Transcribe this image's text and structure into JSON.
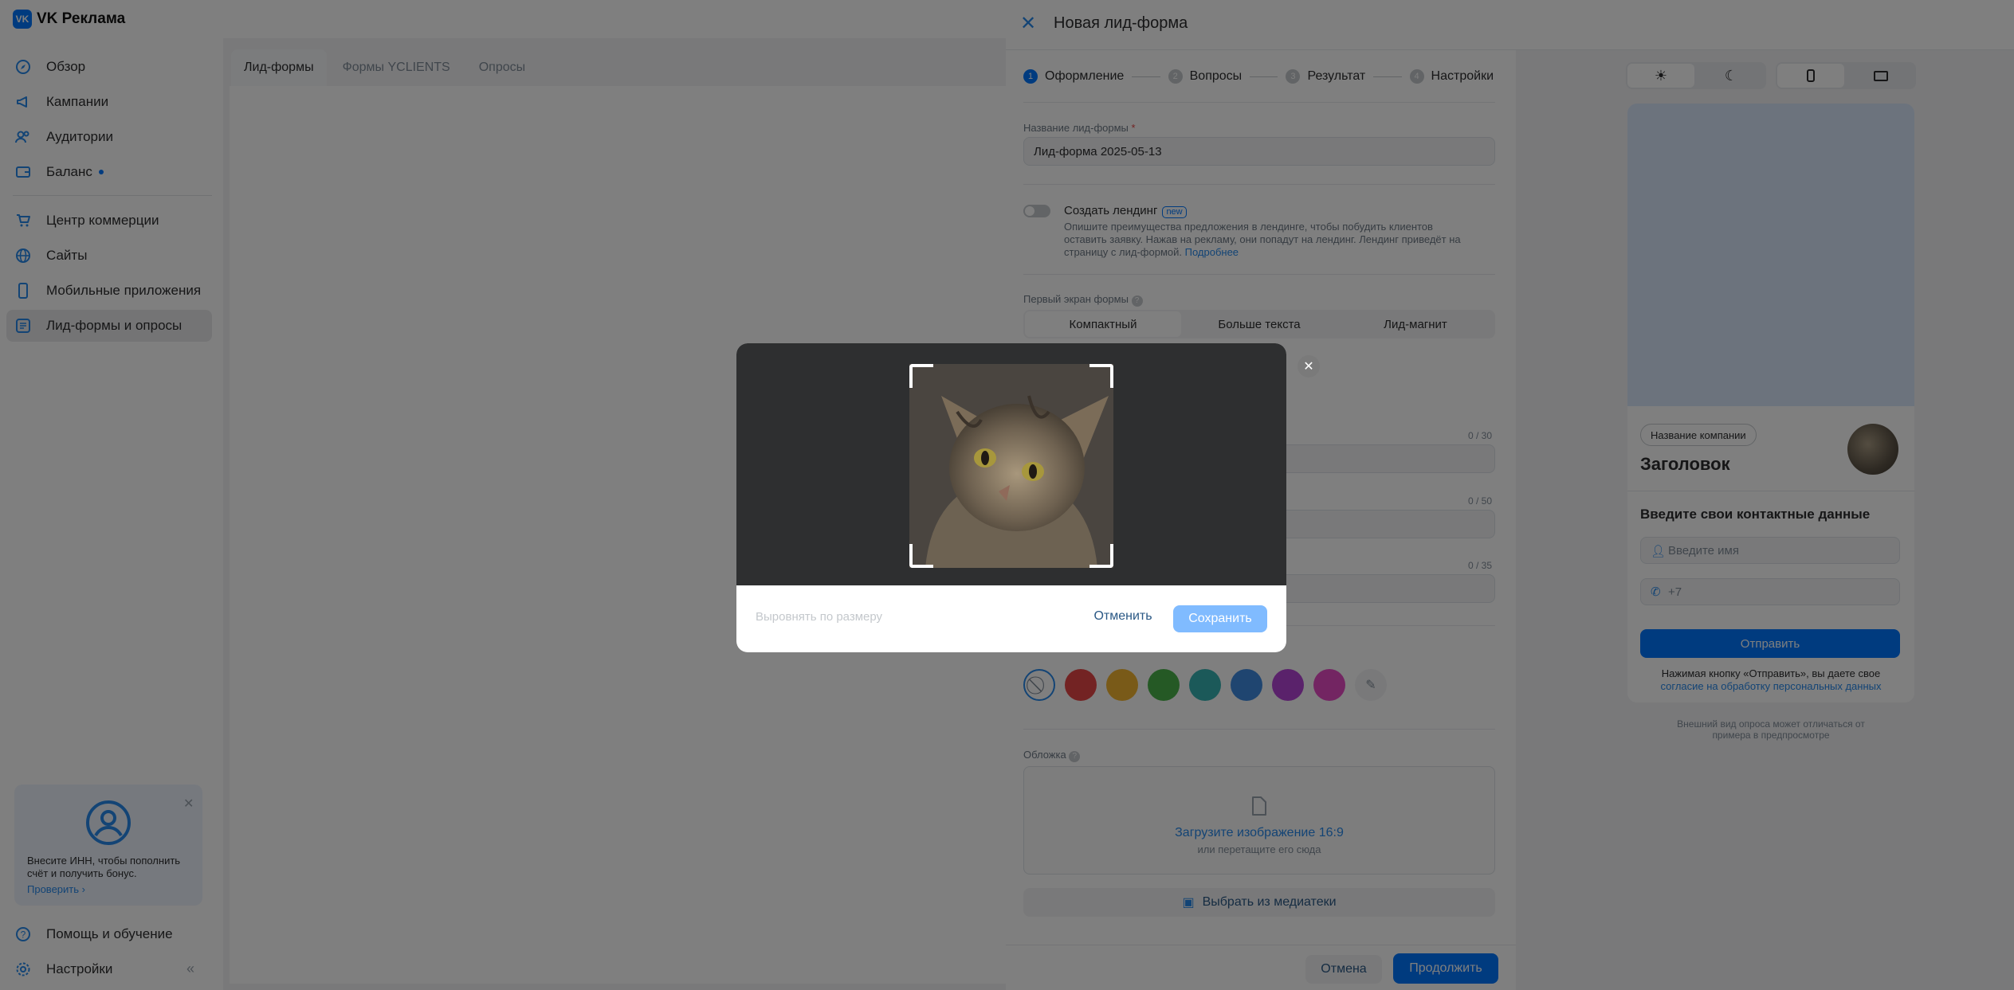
{
  "app": {
    "logo": "VK Реклама"
  },
  "sidebar": {
    "items": [
      {
        "label": "Обзор"
      },
      {
        "label": "Кампании"
      },
      {
        "label": "Аудитории"
      },
      {
        "label": "Баланс"
      },
      {
        "label": "Центр коммерции"
      },
      {
        "label": "Сайты"
      },
      {
        "label": "Мобильные приложения"
      },
      {
        "label": "Лид-формы и опросы"
      }
    ],
    "promo": {
      "text": "Внесите ИНН, чтобы пополнить счёт и получить бонус.",
      "link": "Проверить"
    },
    "help": "Помощь и обучение",
    "settings": "Настройки"
  },
  "main": {
    "tabs": [
      {
        "label": "Лид-формы"
      },
      {
        "label": "Формы YCLIENTS"
      },
      {
        "label": "Опросы"
      }
    ]
  },
  "panel": {
    "title": "Новая лид-форма",
    "steps": [
      {
        "num": "1",
        "label": "Оформление"
      },
      {
        "num": "2",
        "label": "Вопросы"
      },
      {
        "num": "3",
        "label": "Результат"
      },
      {
        "num": "4",
        "label": "Настройки"
      }
    ],
    "name_label": "Название лид-формы",
    "name_required": "*",
    "name_value": "Лид-форма 2025-05-13",
    "landing": {
      "title": "Создать лендинг",
      "badge": "new",
      "desc": "Опишите преимущества предложения в лендинге, чтобы побудить клиентов оставить заявку. Нажав на рекламу, они попадут на лендинг. Лендинг приведёт на страницу с лид-формой.",
      "more": "Подробнее"
    },
    "first_screen_label": "Первый экран формы",
    "first_screen_options": [
      "Компактный",
      "Больше текста",
      "Лид-магнит"
    ],
    "counters": [
      "0 / 30",
      "0 / 50",
      "0 / 35"
    ],
    "cover_label": "Обложка",
    "upload_title": "Загрузите изображение 16:9",
    "upload_hint": "или перетащите его сюда",
    "media_button": "Выбрать из медиатеки",
    "cancel": "Отмена",
    "continue": "Продолжить",
    "colors": [
      "#e64646",
      "#f2b430",
      "#4bb34b",
      "#37b3b3",
      "#3f8ae0",
      "#b544d6",
      "#e64ac5"
    ]
  },
  "preview": {
    "company": "Название компании",
    "heading": "Заголовок",
    "subheading": "Введите свои контактные данные",
    "name_placeholder": "Введите имя",
    "phone_placeholder": "+7",
    "submit": "Отправить",
    "consent_text": "Нажимая кнопку «Отправить», вы даете свое",
    "consent_link": "согласие на обработку персональных данных",
    "note": "Внешний вид опроса может отличаться от примера в предпросмотре"
  },
  "modal": {
    "fit": "Выровнять по размеру",
    "cancel": "Отменить",
    "save": "Сохранить"
  }
}
